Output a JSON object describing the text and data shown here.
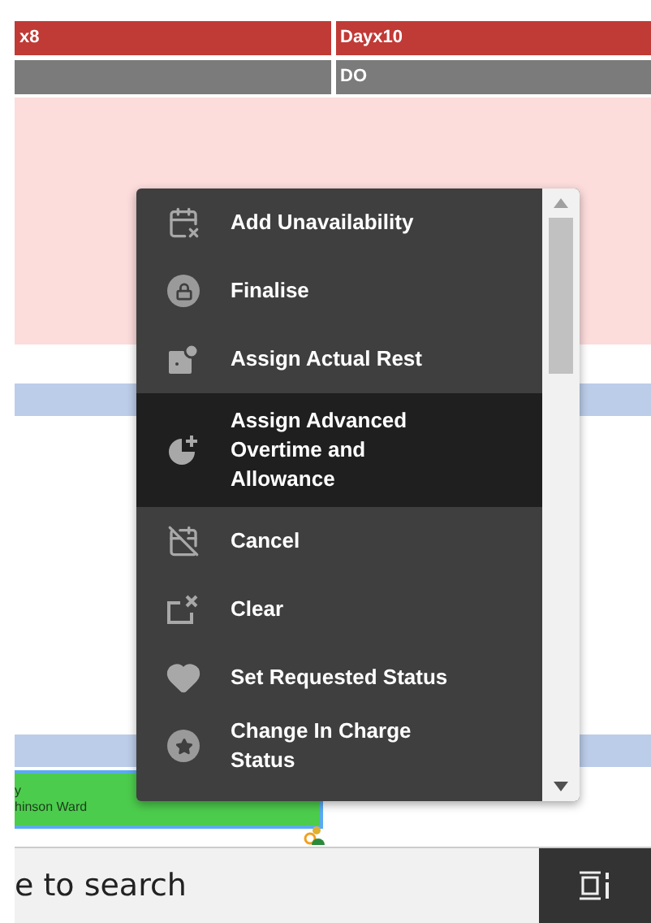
{
  "header": {
    "columns": [
      "x8",
      "Dayx10"
    ]
  },
  "status_row": {
    "columns": [
      "",
      "DO"
    ]
  },
  "shift": {
    "line_1": "y",
    "line_2": "hinson Ward"
  },
  "search": {
    "placeholder": "e to search"
  },
  "context_menu": {
    "items": [
      {
        "label": "Add Unavailability",
        "kind": "calendar-x",
        "selected": false
      },
      {
        "label": "Finalise",
        "kind": "lock",
        "selected": false
      },
      {
        "label": "Assign Actual Rest",
        "kind": "rest",
        "selected": false
      },
      {
        "label": "Assign Advanced Overtime and Allowance",
        "kind": "pie-plus",
        "selected": true
      },
      {
        "label": "Cancel",
        "kind": "calendar-off",
        "selected": false
      },
      {
        "label": "Clear",
        "kind": "clear",
        "selected": false
      },
      {
        "label": "Set Requested Status",
        "kind": "heart",
        "selected": false
      },
      {
        "label": "Change In Charge Status",
        "kind": "star",
        "selected": false
      }
    ]
  }
}
